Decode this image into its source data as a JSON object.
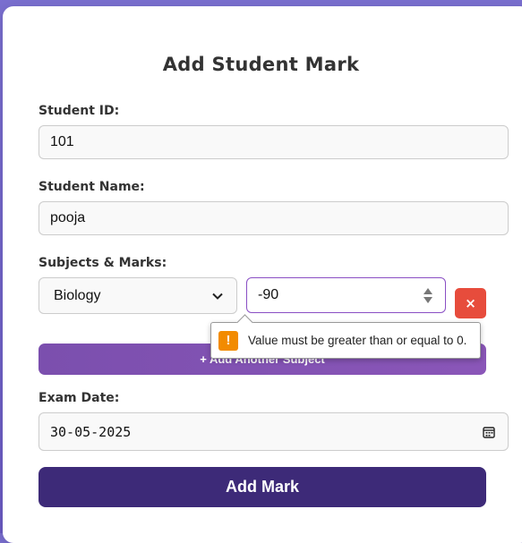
{
  "form": {
    "title": "Add Student Mark",
    "student_id": {
      "label": "Student ID:",
      "value": "101"
    },
    "student_name": {
      "label": "Student Name:",
      "value": "pooja"
    },
    "subjects": {
      "label": "Subjects & Marks:",
      "rows": [
        {
          "subject": "Biology",
          "mark": "-90",
          "remove_label": "×"
        }
      ],
      "add_label": "+ Add Another Subject"
    },
    "validation": {
      "message": "Value must be greater than or equal to 0.",
      "icon": "warning-icon",
      "icon_symbol": "!"
    },
    "exam_date": {
      "label": "Exam Date:",
      "value": "30-05-2025"
    },
    "submit_label": "Add Mark"
  },
  "colors": {
    "background": "#6b5bc4",
    "add_subject_button": "#7b4fae",
    "remove_button": "#e74c3c",
    "submit_button": "#3d2a78",
    "warning": "#f28b00"
  }
}
